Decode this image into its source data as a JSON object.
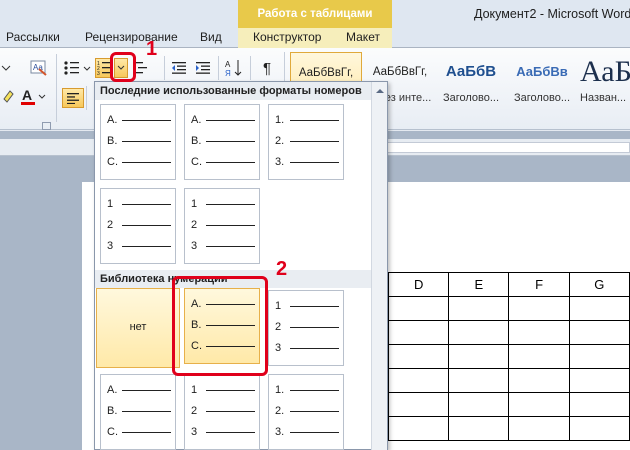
{
  "window": {
    "title": "Документ2 - Microsoft Word",
    "faded_title": "x.doc.chrome"
  },
  "tabs": {
    "mailings": "Рассылки",
    "review": "Рецензирование",
    "view": "Вид",
    "design": "Конструктор",
    "layout": "Макет",
    "context_group": "Работа с таблицами"
  },
  "ribbon": {
    "paragraph_mark": "¶",
    "sort": "↓А↑Я",
    "styles": [
      {
        "sample": "АаБбВвГг,",
        "name": ""
      },
      {
        "sample": "АаБбВвГг,",
        "name": "¶ Без инте..."
      },
      {
        "sample": "АаБбВ",
        "name": "Заголово..."
      },
      {
        "sample": "АаБбВв",
        "name": "Заголово..."
      },
      {
        "sample": "АаБ",
        "name": "Назван..."
      }
    ]
  },
  "dropdown": {
    "recent_header": "Последние использованные форматы номеров",
    "library_header": "Библиотека нумерации",
    "none_label": "нет",
    "recent": [
      [
        "A.",
        "B.",
        "C."
      ],
      [
        "A.",
        "B.",
        "C."
      ],
      [
        "1.",
        "2.",
        "3."
      ],
      [
        "1",
        "2",
        "3"
      ],
      [
        "1",
        "2",
        "3"
      ]
    ],
    "library": [
      [
        "A.",
        "B.",
        "C."
      ],
      [
        "1",
        "2",
        "3"
      ],
      [
        "A.",
        "B.",
        "C."
      ],
      [
        "1",
        "2",
        "3"
      ],
      [
        "1.",
        "2.",
        "3."
      ]
    ]
  },
  "table": {
    "headers": [
      "D",
      "E",
      "F",
      "G"
    ]
  },
  "callouts": {
    "one": "1",
    "two": "2"
  },
  "colors": {
    "accent": "#e0001b",
    "context_tab": "#e8c94a",
    "font_color": "#e00000"
  }
}
